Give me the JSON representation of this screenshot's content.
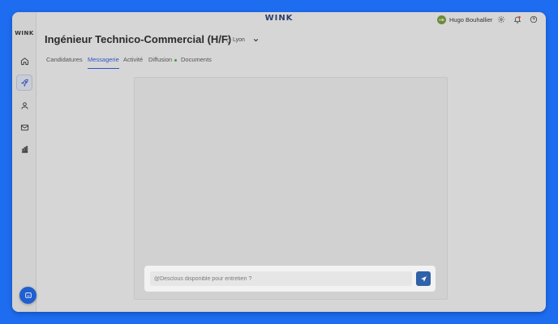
{
  "app": {
    "logo_top": "WINK",
    "logo_side": "WINK"
  },
  "user": {
    "initials": "HB",
    "name": "Hugo Bouhallier"
  },
  "sidebar": {
    "items": [
      {
        "icon": "home-icon"
      },
      {
        "icon": "rocket-icon",
        "active": true
      },
      {
        "icon": "user-icon"
      },
      {
        "icon": "mail-icon"
      },
      {
        "icon": "chart-icon"
      }
    ]
  },
  "job": {
    "title": "Ingénieur Technico-Commercial (H/F)",
    "location": "Lyon"
  },
  "tabs": [
    {
      "label": "Candidatures"
    },
    {
      "label": "Messagerie",
      "active": true
    },
    {
      "label": "Activité"
    },
    {
      "label": "Diffusion"
    },
    {
      "label": "Documents"
    }
  ],
  "composer": {
    "placeholder": "@Desclous disponible pour entretien ?"
  },
  "colors": {
    "brand_blue": "#1e6cf0",
    "accent": "#2f56c4",
    "send": "#2f62a8",
    "status_green": "#3a9a4a"
  }
}
